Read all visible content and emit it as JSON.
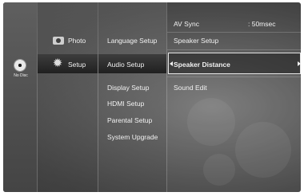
{
  "disc_status": {
    "label": "No Disc",
    "icon": "disc-icon"
  },
  "main_menu": {
    "items": [
      {
        "label": "Photo",
        "icon": "photo-icon"
      },
      {
        "label": "Setup",
        "icon": "gear-icon",
        "selected": true
      }
    ]
  },
  "setup_menu": {
    "items": [
      {
        "label": "Language Setup"
      },
      {
        "label": "Audio Setup",
        "selected": true
      },
      {
        "label": "Display Setup"
      },
      {
        "label": "HDMI Setup"
      },
      {
        "label": "Parental Setup"
      },
      {
        "label": "System Upgrade"
      }
    ]
  },
  "audio_menu": {
    "items": [
      {
        "label": "AV Sync",
        "value": ": 50msec"
      },
      {
        "label": "Speaker Setup"
      },
      {
        "label": "Speaker Distance",
        "selected": true
      },
      {
        "label": "Sound Edit"
      }
    ]
  },
  "colors": {
    "selection_outline": "#e5e5e5",
    "text": "#f2f2f2"
  }
}
